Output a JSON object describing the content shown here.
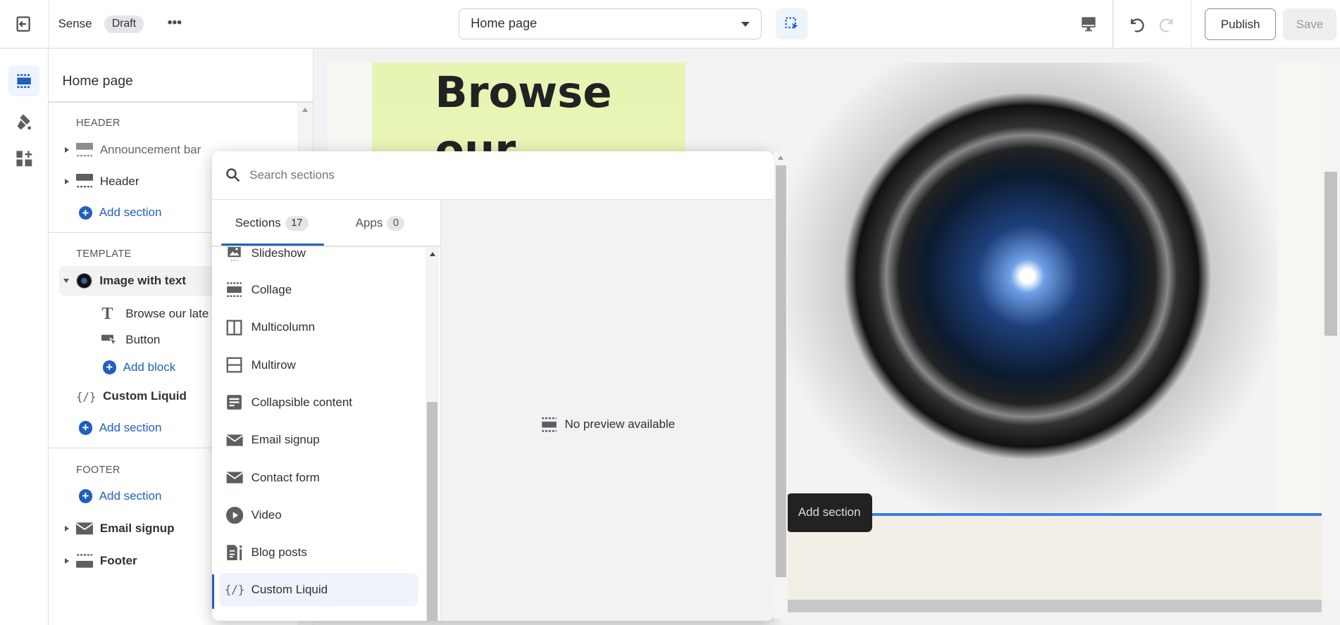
{
  "topbar": {
    "theme_name": "Sense",
    "status_badge": "Draft",
    "more": "•••",
    "page_select": "Home page",
    "publish": "Publish",
    "save": "Save"
  },
  "sidebar": {
    "title": "Home page",
    "header_label": "HEADER",
    "announcement_bar": "Announcement bar",
    "header": "Header",
    "add_section": "Add section",
    "template_label": "TEMPLATE",
    "image_with_text": "Image with text",
    "block_text": "Browse our late",
    "block_button": "Button",
    "add_block": "Add block",
    "custom_liquid": "Custom Liquid",
    "footer_label": "FOOTER",
    "email_signup": "Email signup",
    "footer": "Footer"
  },
  "preview": {
    "heading": "Browse our",
    "add_section_tooltip": "Add section"
  },
  "popup": {
    "search_placeholder": "Search sections",
    "tabs": [
      {
        "label": "Sections",
        "count": "17"
      },
      {
        "label": "Apps",
        "count": "0"
      }
    ],
    "items": [
      "Slideshow",
      "Collage",
      "Multicolumn",
      "Multirow",
      "Collapsible content",
      "Email signup",
      "Contact form",
      "Video",
      "Blog posts",
      "Custom Liquid"
    ],
    "selected": "Custom Liquid",
    "no_preview": "No preview available"
  },
  "colors": {
    "accent": "#1f5fbf",
    "preview_green": "#e6f5b2"
  }
}
